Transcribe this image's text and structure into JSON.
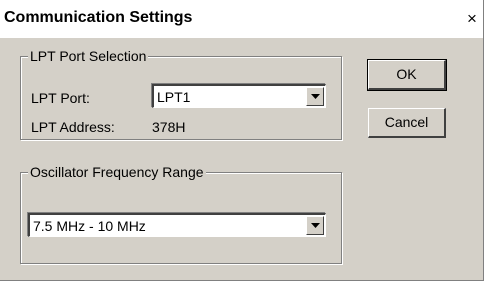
{
  "window": {
    "title": "Communication Settings",
    "close_glyph": "×"
  },
  "lpt_group": {
    "title": "LPT Port Selection",
    "port_label": "LPT Port:",
    "port_value": "LPT1",
    "address_label": "LPT Address:",
    "address_value": "378H"
  },
  "osc_group": {
    "title": "Oscillator Frequency Range",
    "range_value": "7.5 MHz - 10 MHz"
  },
  "buttons": {
    "ok": "OK",
    "cancel": "Cancel"
  },
  "icons": {
    "close": "close-icon",
    "dropdown": "chevron-down-icon"
  },
  "colors": {
    "face": "#d4d0c8",
    "shadow": "#808080",
    "highlight": "#ffffff"
  }
}
